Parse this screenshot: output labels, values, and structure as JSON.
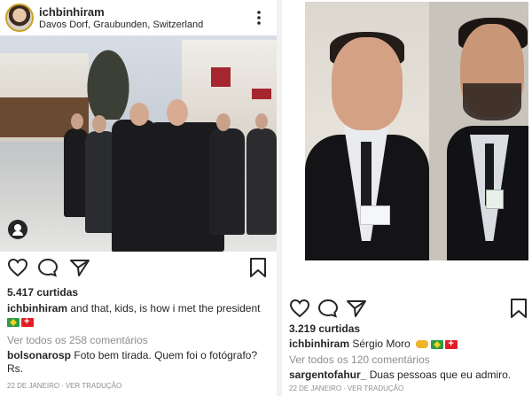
{
  "left_post": {
    "username": "ichbinhiram",
    "location": "Davos Dorf, Graubunden, Switzerland",
    "more_icon": "more-vertical-icon",
    "photo_description_icon": "user-tag-icon",
    "actions": {
      "like_icon": "heart-icon",
      "comment_icon": "comment-icon",
      "share_icon": "send-icon",
      "save_icon": "bookmark-icon"
    },
    "likes": "5.417 curtidas",
    "caption_user": "ichbinhiram",
    "caption_text": "and that, kids, is how i met the president",
    "view_comments": "Ver todos os 258 comentários",
    "comment_user": "bolsonarosp",
    "comment_text": "Foto bem tirada. Quem foi o fotógrafo? Rs.",
    "date": "22 DE JANEIRO",
    "translate": "VER TRADUÇÃO"
  },
  "right_post": {
    "actions": {
      "like_icon": "heart-icon",
      "comment_icon": "comment-icon",
      "share_icon": "send-icon",
      "save_icon": "bookmark-icon"
    },
    "likes": "3.219 curtidas",
    "caption_user": "ichbinhiram",
    "caption_text": "Sérgio Moro",
    "view_comments": "Ver todos os 120 comentários",
    "comment_user": "sargentofahur_",
    "comment_text": "Duas pessoas que eu admiro.",
    "date": "22 DE JANEIRO",
    "translate": "VER TRADUÇÃO"
  },
  "colors": {
    "text": "#262626",
    "muted": "#8e8e8e",
    "flag_brazil": "#2e9b45",
    "flag_swiss": "#e41e26"
  }
}
